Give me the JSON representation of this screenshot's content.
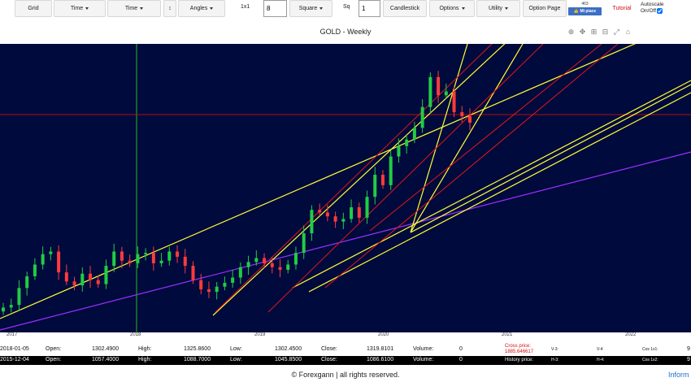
{
  "toolbar": {
    "grid_label": "Grid",
    "time1_label": "Time",
    "time2_label": "Time",
    "arrows_label": "↕",
    "angles_label": "Angles",
    "ratio_label": "1x1",
    "ratio_value": "8",
    "square_label": "Square",
    "sq_label": "Sq",
    "sq_value": "1",
    "candlestick_label": "Candlestick",
    "options_label": "Options",
    "utility_label": "Utility",
    "option_page_label": "Option Page",
    "like_count": "463",
    "like_label": "Mi piace",
    "tutorial_label": "Tutorial",
    "autoscale_label": "Autoscale",
    "autoscale_onoff": "On/Off",
    "autoscale_checked": true
  },
  "chart": {
    "title": "GOLD - Weekly",
    "tools": [
      "zoom-icon",
      "pan-icon",
      "zoom-in-icon",
      "zoom-out-icon",
      "autoscale-icon",
      "reset-icon"
    ],
    "tool_glyphs": [
      "⊕",
      "✥",
      "⊞",
      "⊟",
      "⤢",
      "⌂"
    ],
    "background": "#000a3d",
    "x_ticks": [
      "2017",
      "2018",
      "2019",
      "2020",
      "2021",
      "2022"
    ]
  },
  "chart_data": {
    "type": "candlestick",
    "title": "GOLD - Weekly",
    "x_ticks": [
      "2017",
      "2018",
      "2019",
      "2020",
      "2021",
      "2022"
    ],
    "approx_weekly_close": [
      1130,
      1140,
      1205,
      1250,
      1295,
      1335,
      1345,
      1265,
      1230,
      1215,
      1260,
      1235,
      1220,
      1290,
      1345,
      1310,
      1300,
      1335,
      1340,
      1300,
      1310,
      1345,
      1325,
      1290,
      1235,
      1200,
      1190,
      1210,
      1225,
      1245,
      1285,
      1305,
      1320,
      1300,
      1285,
      1275,
      1295,
      1340,
      1415,
      1505,
      1495,
      1480,
      1460,
      1470,
      1515,
      1475,
      1555,
      1640,
      1600,
      1710,
      1750,
      1775,
      1820,
      1900,
      2015,
      1945,
      1960,
      1880,
      1865,
      1840
    ],
    "overlay_lines": [
      "yellow trend channels",
      "red trend channels",
      "purple trend line",
      "green vertical marker",
      "red horizontal marker"
    ]
  },
  "row1": {
    "date": "2018-01-05",
    "open_label": "Open:",
    "open": "1302.4900",
    "high_label": "High:",
    "high": "1325.8600",
    "low_label": "Low:",
    "low": "1302.4500",
    "close_label": "Close:",
    "close": "1319.8101",
    "volume_label": "Volume:",
    "volume": "0",
    "v3": "V-3:",
    "v4": "V-4",
    "cos1": "Cos 1x1:",
    "tail": "9"
  },
  "row2": {
    "date": "2015-12-04",
    "open_label": "Open:",
    "open": "1057.4000",
    "high_label": "High:",
    "high": "1088.7000",
    "low_label": "Low:",
    "low": "1045.8500",
    "close_label": "Close:",
    "close": "1086.6100",
    "volume_label": "Volume:",
    "volume": "0",
    "history_label": "History price:",
    "h3": "H-3:",
    "h4": "H-4:",
    "cos2": "Cos 1x2:",
    "tail": "9"
  },
  "cross_price": {
    "label": "Cross price:",
    "value": "1885.646617"
  },
  "footer": {
    "text": "© Forexgann | all rights reserved.",
    "link": "Inform"
  }
}
